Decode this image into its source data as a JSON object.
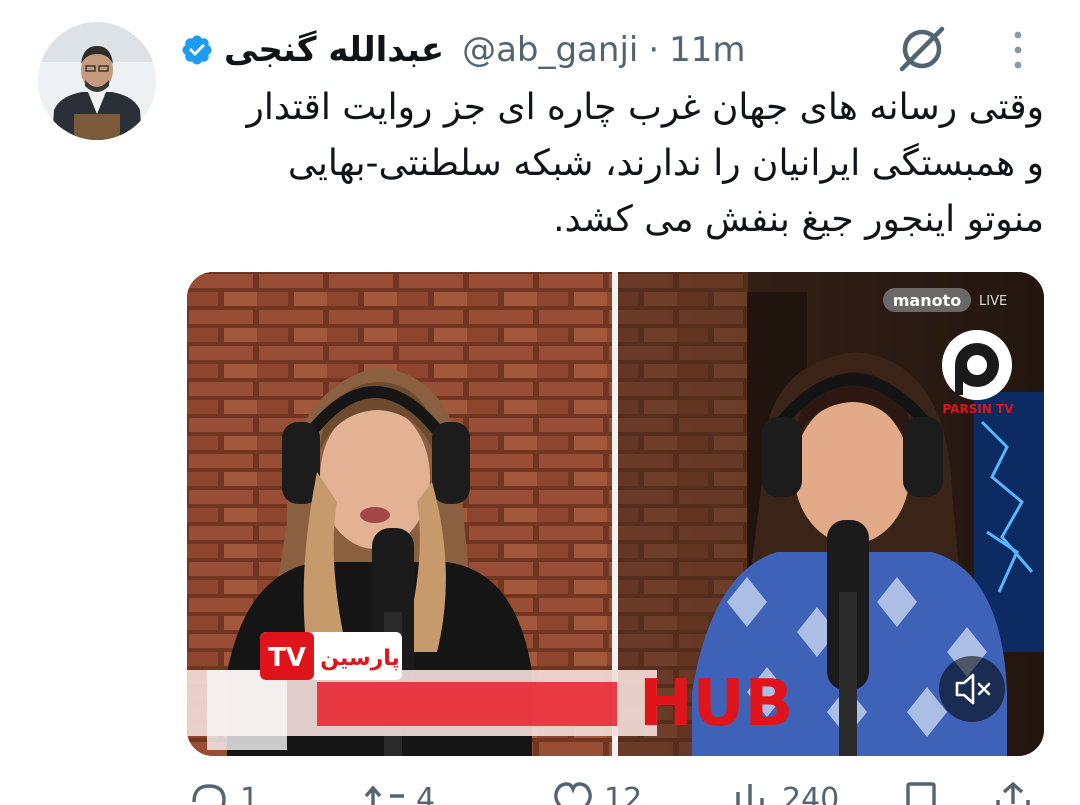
{
  "tweet": {
    "author_name": "عبدالله گنجی",
    "handle": "@ab_ganji",
    "separator": "·",
    "timestamp": "11m",
    "text_lines": [
      "وقتی رسانه های جهان غرب چاره ای جز روایت اقتدار",
      "و همبستگی ایرانیان را ندارند، شبکه سلطنتی-بهایی",
      "منوتو اینجور جیغ بنفش می کشد."
    ]
  },
  "media": {
    "left_channel_logo": "پارسین",
    "left_channel_logo_tv": "TV",
    "hub_text": "HUB",
    "watermark_brand": "manoto",
    "watermark_live": "LIVE",
    "parsin_tv_label": "PARSIN TV"
  },
  "actions": {
    "reply_count": "1",
    "retweet_count": "4",
    "like_count": "12",
    "views_count": "240"
  },
  "colors": {
    "verified": "#1d9bf0",
    "secondary_text": "#536471",
    "accent_red": "#e0141b"
  },
  "icons": [
    "verified-badge-icon",
    "grok-icon",
    "more-icon",
    "mute-icon",
    "reply-icon",
    "retweet-icon",
    "like-icon",
    "views-icon",
    "bookmark-icon"
  ]
}
